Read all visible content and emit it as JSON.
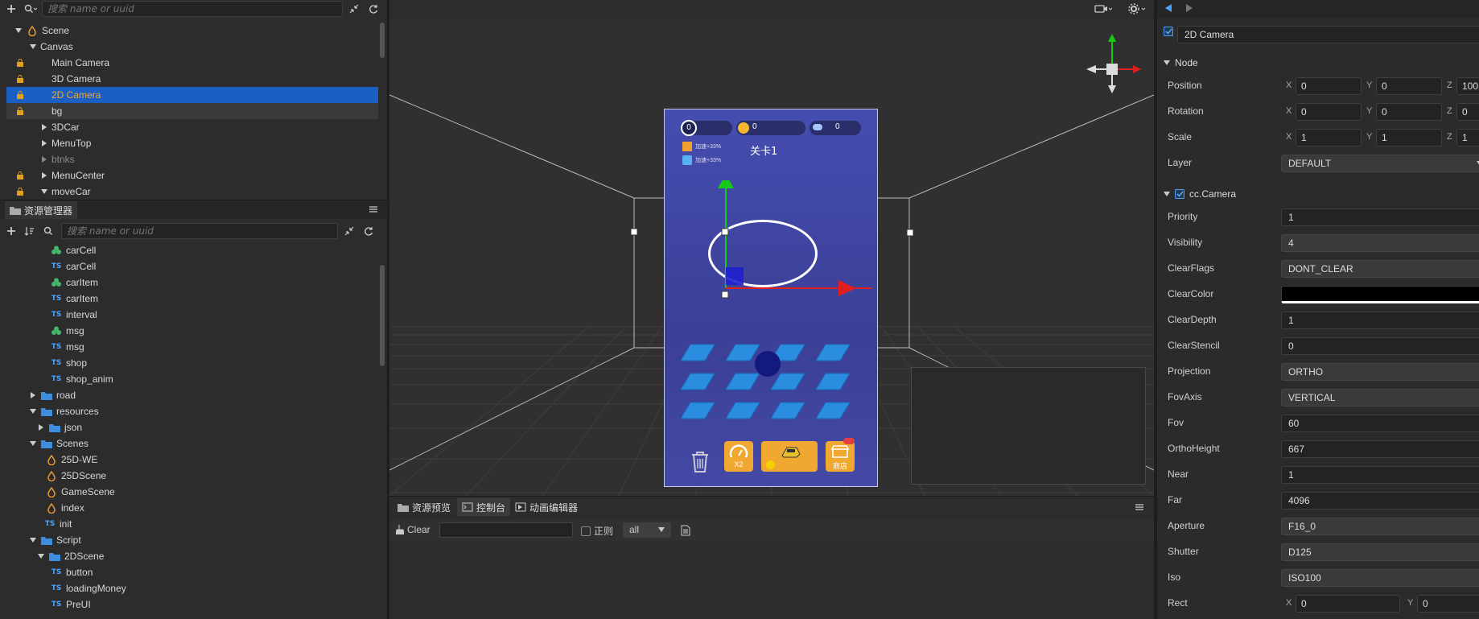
{
  "hierarchy": {
    "search_placeholder": "搜索 name or uuid",
    "nodes": [
      {
        "label": "Scene"
      },
      {
        "label": "Canvas"
      },
      {
        "label": "Main Camera"
      },
      {
        "label": "3D Camera"
      },
      {
        "label": "2D Camera"
      },
      {
        "label": "bg"
      },
      {
        "label": "3DCar"
      },
      {
        "label": "MenuTop"
      },
      {
        "label": "btnks"
      },
      {
        "label": "MenuCenter"
      },
      {
        "label": "moveCar"
      }
    ]
  },
  "assets": {
    "tab_label": "资源管理器",
    "search_placeholder": "搜索 name or uuid",
    "items": [
      {
        "label": "carCell",
        "icon": "prefab-icon"
      },
      {
        "label": "carCell",
        "icon": "ts-icon"
      },
      {
        "label": "carItem",
        "icon": "prefab-icon"
      },
      {
        "label": "carItem",
        "icon": "ts-icon"
      },
      {
        "label": "interval",
        "icon": "ts-icon"
      },
      {
        "label": "msg",
        "icon": "prefab-icon"
      },
      {
        "label": "msg",
        "icon": "ts-icon"
      },
      {
        "label": "shop",
        "icon": "ts-icon"
      },
      {
        "label": "shop_anim",
        "icon": "ts-icon"
      },
      {
        "label": "road",
        "icon": "folder-icon"
      },
      {
        "label": "resources",
        "icon": "folder-icon"
      },
      {
        "label": "json",
        "icon": "folder-icon"
      },
      {
        "label": "Scenes",
        "icon": "folder-icon"
      },
      {
        "label": "25D-WE",
        "icon": "scene-icon"
      },
      {
        "label": "25DScene",
        "icon": "scene-icon"
      },
      {
        "label": "GameScene",
        "icon": "scene-icon"
      },
      {
        "label": "index",
        "icon": "scene-icon"
      },
      {
        "label": "init",
        "icon": "ts-icon"
      },
      {
        "label": "Script",
        "icon": "folder-icon"
      },
      {
        "label": "2DScene",
        "icon": "folder-icon"
      },
      {
        "label": "button",
        "icon": "ts-icon"
      },
      {
        "label": "loadingMoney",
        "icon": "ts-icon"
      },
      {
        "label": "PreUI",
        "icon": "ts-icon"
      }
    ],
    "ts_badge": "TS"
  },
  "game_preview": {
    "counter_a": "0",
    "counter_b": "0",
    "counter_c": "0",
    "level_title": "关卡1",
    "buff_1": "加速+33%",
    "buff_2": "加速+33%",
    "btn_speed": "X2",
    "btn_shop": "商店"
  },
  "console": {
    "tabs": [
      "资源预览",
      "控制台",
      "动画编辑器"
    ],
    "clear_label": "Clear",
    "regex_label": "正则",
    "filter_value": "all"
  },
  "inspector": {
    "node_name": "2D Camera",
    "node_section": "Node",
    "position": {
      "label": "Position",
      "x": "0",
      "y": "0",
      "z": "100"
    },
    "rotation": {
      "label": "Rotation",
      "x": "0",
      "y": "0",
      "z": "0"
    },
    "scale": {
      "label": "Scale",
      "x": "1",
      "y": "1",
      "z": "1"
    },
    "layer": {
      "label": "Layer",
      "value": "DEFAULT"
    },
    "camera_section": "cc.Camera",
    "props": [
      {
        "label": "Priority",
        "value": "1",
        "kind": "field"
      },
      {
        "label": "Visibility",
        "value": "4",
        "kind": "select"
      },
      {
        "label": "ClearFlags",
        "value": "DONT_CLEAR",
        "kind": "select"
      },
      {
        "label": "ClearColor",
        "value": "",
        "kind": "color"
      },
      {
        "label": "ClearDepth",
        "value": "1",
        "kind": "field"
      },
      {
        "label": "ClearStencil",
        "value": "0",
        "kind": "field"
      },
      {
        "label": "Projection",
        "value": "ORTHO",
        "kind": "select"
      },
      {
        "label": "FovAxis",
        "value": "VERTICAL",
        "kind": "select"
      },
      {
        "label": "Fov",
        "value": "60",
        "kind": "field"
      },
      {
        "label": "OrthoHeight",
        "value": "667",
        "kind": "field"
      },
      {
        "label": "Near",
        "value": "1",
        "kind": "field"
      },
      {
        "label": "Far",
        "value": "4096",
        "kind": "field"
      },
      {
        "label": "Aperture",
        "value": "F16_0",
        "kind": "select"
      },
      {
        "label": "Shutter",
        "value": "D125",
        "kind": "select"
      },
      {
        "label": "Iso",
        "value": "ISO100",
        "kind": "select"
      }
    ],
    "rect": {
      "label": "Rect",
      "x": "0",
      "y": "0"
    },
    "clear_color_hex": "#000000"
  },
  "colors": {
    "selection": "#1b5fc4",
    "accent": "#4aa3ff",
    "game_bg": "#4048a8"
  }
}
